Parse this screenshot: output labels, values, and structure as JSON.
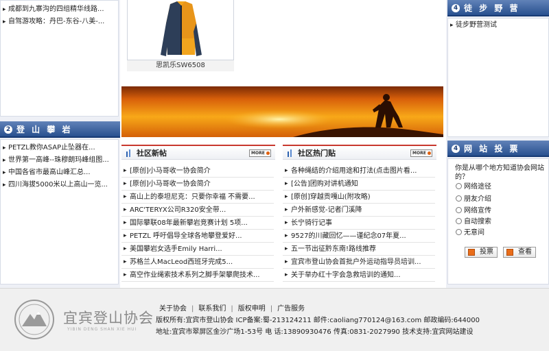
{
  "left": {
    "top_items": [
      "成都到九寨沟的四组精华线路...",
      "自驾游攻略：丹巴-东谷-八美-..."
    ],
    "climbing": {
      "num": "2",
      "title": "登 山 攀 岩",
      "items": [
        "PETZL教你ASAP止坠器在...",
        "世界第一高峰--珠穆朗玛峰组图...",
        "中国各省市最高山峰汇总...",
        "四川海拔5000米以上高山一览..."
      ]
    }
  },
  "product": {
    "caption": "思凯乐SW6508"
  },
  "center": {
    "new_posts": {
      "title": "社区新帖",
      "more": "MORE",
      "items": [
        "[原创]小马哥收一协会简介",
        "[原创]小马哥收一协会简介",
        "高山上的泰坦尼克：只要你幸福 不需要...",
        "ARC'TERYX公司R320安全带...",
        "国际攀联08年最新攀岩竞赛计划 5项...",
        "PETZL 呼吁倡导全球各地攀登爱好...",
        "美国攀岩女选手Emily Harri...",
        "苏格兰人MacLeod西班牙完成5...",
        "高空作业绳索技术系列之脚手架攀爬技术..."
      ]
    },
    "hot_posts": {
      "title": "社区热门贴",
      "more": "MORE",
      "items": [
        "各种绳结的介绍用途和打法(点击图片看...",
        "[公告]团购对讲机通知",
        "[原创]穿越贡嘎山(附攻略)",
        "户外新感觉-记者门溪降",
        "长宁骑行记事",
        "9527的川藏回忆——谨纪念07年夏...",
        "五一节出征黔东南!路线推荐",
        "宜宾市登山协会首批户外运动指导员培训...",
        "关于举办红十字会急救培训的通知..."
      ]
    }
  },
  "right": {
    "hiking": {
      "num": "4",
      "title": "徒 步 野 营",
      "items": [
        "徒步野营测试"
      ]
    },
    "poll": {
      "num": "4",
      "title": "网 站 投 票",
      "question": "你是从哪个地方知道协会网站的？",
      "options": [
        "网络途径",
        "朋友介绍",
        "网络宣传",
        "自动搜索",
        "无意间"
      ],
      "vote_label": "投票",
      "view_label": "查看"
    }
  },
  "footer": {
    "links": [
      "关于协会",
      "联系我们",
      "版权申明",
      "广告服务"
    ],
    "copyright": "版权所有:宜宾市登山协会 ICP备案:蜀-213124211 邮件:caoliang770124@163.com 邮政编码:644000",
    "address": "地址:宜宾市翠屏区金沙广场1-53号 电 话:13890930476 传真:0831-2027990 技术支持:宜宾网站建设",
    "logo_text": "宜宾登山协会",
    "logo_pinyin": "YIBIN DENG SHAN XIE HUI"
  },
  "colors": {
    "header_blue": "#28508f",
    "accent_red": "#c8372d",
    "banner_orange": "#f59a12"
  }
}
